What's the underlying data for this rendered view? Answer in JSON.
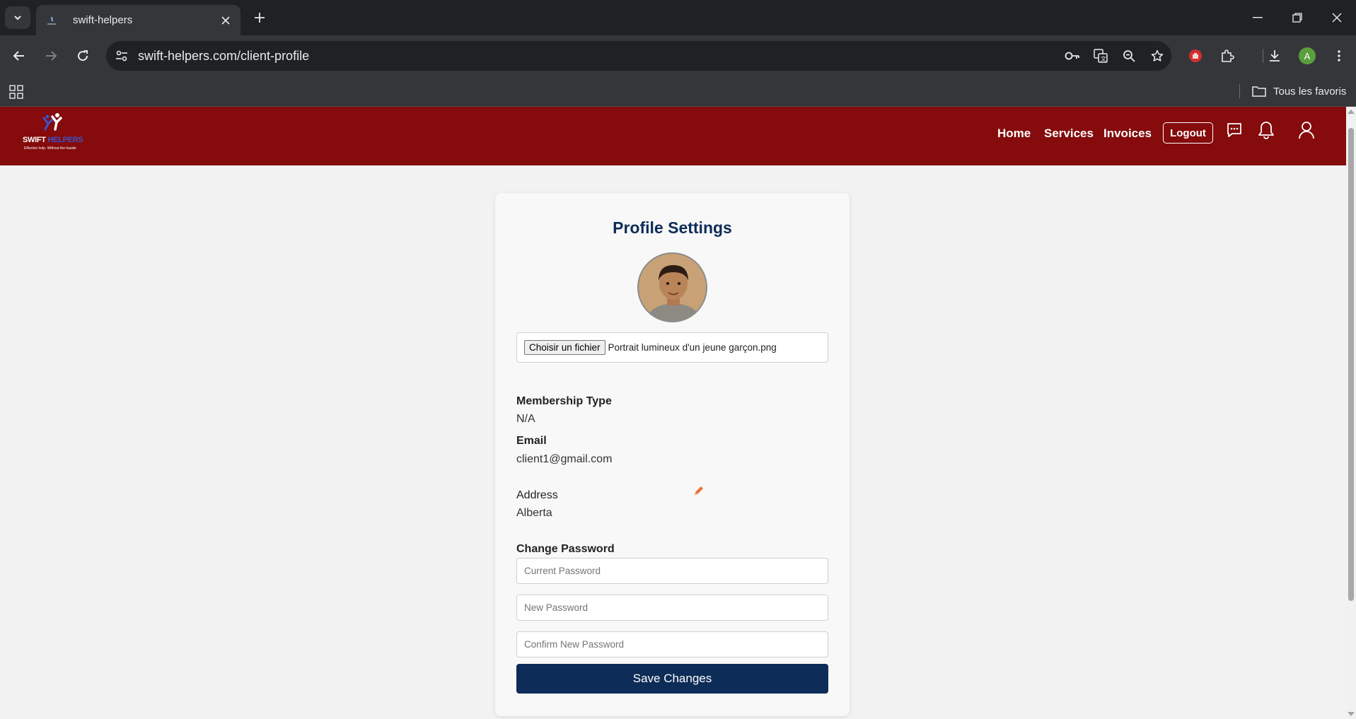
{
  "browser": {
    "tab_title": "swift-helpers",
    "url": "swift-helpers.com/client-profile",
    "profile_initial": "A",
    "bookmarks_all_label": "Tous les favoris"
  },
  "header": {
    "logo": {
      "brand_part1": "SWIFT",
      "brand_part2": " HELPERS",
      "tagline": "Effective help. Without the hassle"
    },
    "nav": {
      "home": "Home",
      "services": "Services",
      "invoices": "Invoices",
      "logout": "Logout"
    },
    "colors": {
      "header_bg": "#850b0c",
      "primary": "#0d2c57"
    }
  },
  "profile": {
    "title": "Profile Settings",
    "file_button_label": "Choisir un fichier",
    "file_name": "Portrait lumineux d'un jeune garçon.png",
    "membership_label": "Membership Type",
    "membership_value": "N/A",
    "email_label": "Email",
    "email_value": "client1@gmail.com",
    "address_label": "Address",
    "address_value": "Alberta",
    "change_password_label": "Change Password",
    "current_password_placeholder": "Current Password",
    "new_password_placeholder": "New Password",
    "confirm_password_placeholder": "Confirm New Password",
    "save_label": "Save Changes"
  },
  "icons": {
    "tab_list": "chevron-down-icon",
    "close_tab": "close-icon",
    "new_tab": "plus-icon",
    "back": "arrow-left-icon",
    "forward": "arrow-right-icon",
    "reload": "reload-icon",
    "site_info": "tune-icon",
    "password": "key-icon",
    "translate": "translate-icon",
    "zoom": "zoom-out-icon",
    "bookmark": "star-icon",
    "extension_blocker": "hand-stop-icon",
    "extensions": "puzzle-icon",
    "download": "download-icon",
    "menu": "kebab-menu-icon",
    "apps": "apps-grid-icon",
    "folder": "folder-icon",
    "chat": "chat-icon",
    "notifications": "bell-icon",
    "user": "user-icon",
    "edit": "pencil-icon"
  }
}
